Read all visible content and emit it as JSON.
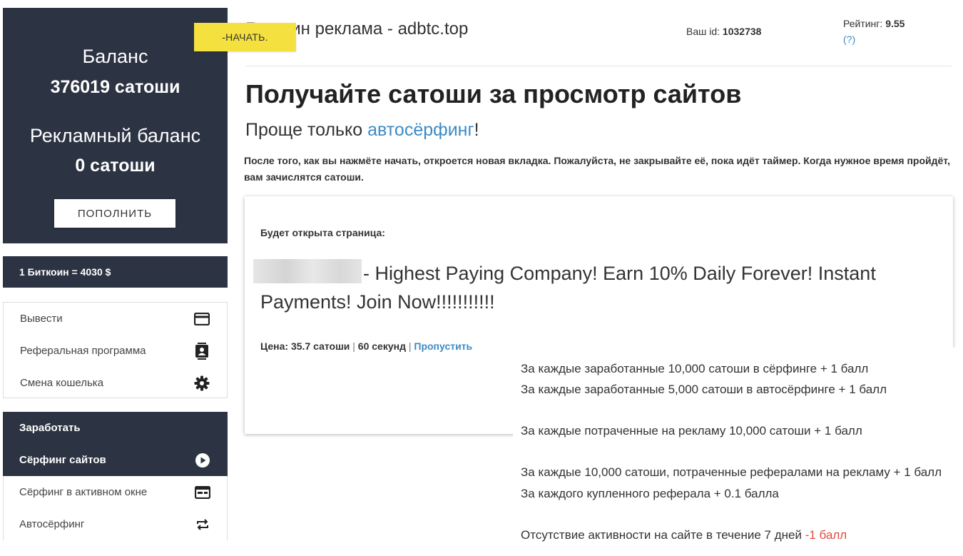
{
  "sidebar": {
    "balance_label": "Баланс",
    "balance_value": "376019 сатоши",
    "ad_balance_label": "Рекламный баланс",
    "ad_balance_value": "0 сатоши",
    "topup_label": "ПОПОЛНИТЬ",
    "rate": "1 Биткоин = 4030 $",
    "menu": [
      {
        "label": "Вывести",
        "icon": "card-icon"
      },
      {
        "label": "Реферальная программа",
        "icon": "contact-card-icon"
      },
      {
        "label": "Смена кошелька",
        "icon": "gear-icon"
      }
    ],
    "earn_header": "Заработать",
    "earn_items": [
      {
        "label": "Сёрфинг сайтов",
        "icon": "play-circle-icon",
        "active": true
      },
      {
        "label": "Сёрфинг в активном окне",
        "icon": "window-icon"
      },
      {
        "label": "Автосёрфинг",
        "icon": "repeat-icon"
      }
    ]
  },
  "header": {
    "site_title": "Биткоин реклама - adbtc.top",
    "start_label": "-НАЧАТЬ.",
    "user_id_label": "Ваш id:",
    "user_id_value": "1032738",
    "rating_label": "Рейтинг:",
    "rating_value": "9.55",
    "rating_help": "(?)"
  },
  "main": {
    "heading": "Получайте сатоши за просмотр сайтов",
    "subheading_prefix": "Проще только ",
    "subheading_link": "автосёрфинг",
    "subheading_suffix": "!",
    "description": "После того, как вы нажмёте начать, откроется новая вкладка. Пожалуйста, не закрывайте её, пока идёт таймер. Когда нужное время пройдёт, вам зачислятся сатоши.",
    "ad_card": {
      "label": "Будет открыта страница:",
      "title": "- Highest Paying Company! Earn 10% Daily Forever! Instant Payments! Join Now!!!!!!!!!!!",
      "price_label": "Цена:",
      "price_value": "35.7 сатоши",
      "duration": "60 секунд",
      "skip": "Пропустить",
      "separator": "|"
    }
  },
  "rules": {
    "lines": [
      "За каждые заработанные 10,000 сатоши в сёрфинге + 1 балл",
      "За каждые заработанные 5,000 сатоши в автосёрфинге + 1 балл",
      "За каждые потраченные на рекламу 10,000 сатоши + 1 балл",
      "За каждые 10,000 сатоши, потраченные рефералами на рекламу + 1 балл",
      "За каждого купленного реферала + 0.1 балла"
    ],
    "inactivity_text": "Отсутствие активности на сайте в течение 7 дней ",
    "inactivity_penalty": "-1 балл"
  }
}
